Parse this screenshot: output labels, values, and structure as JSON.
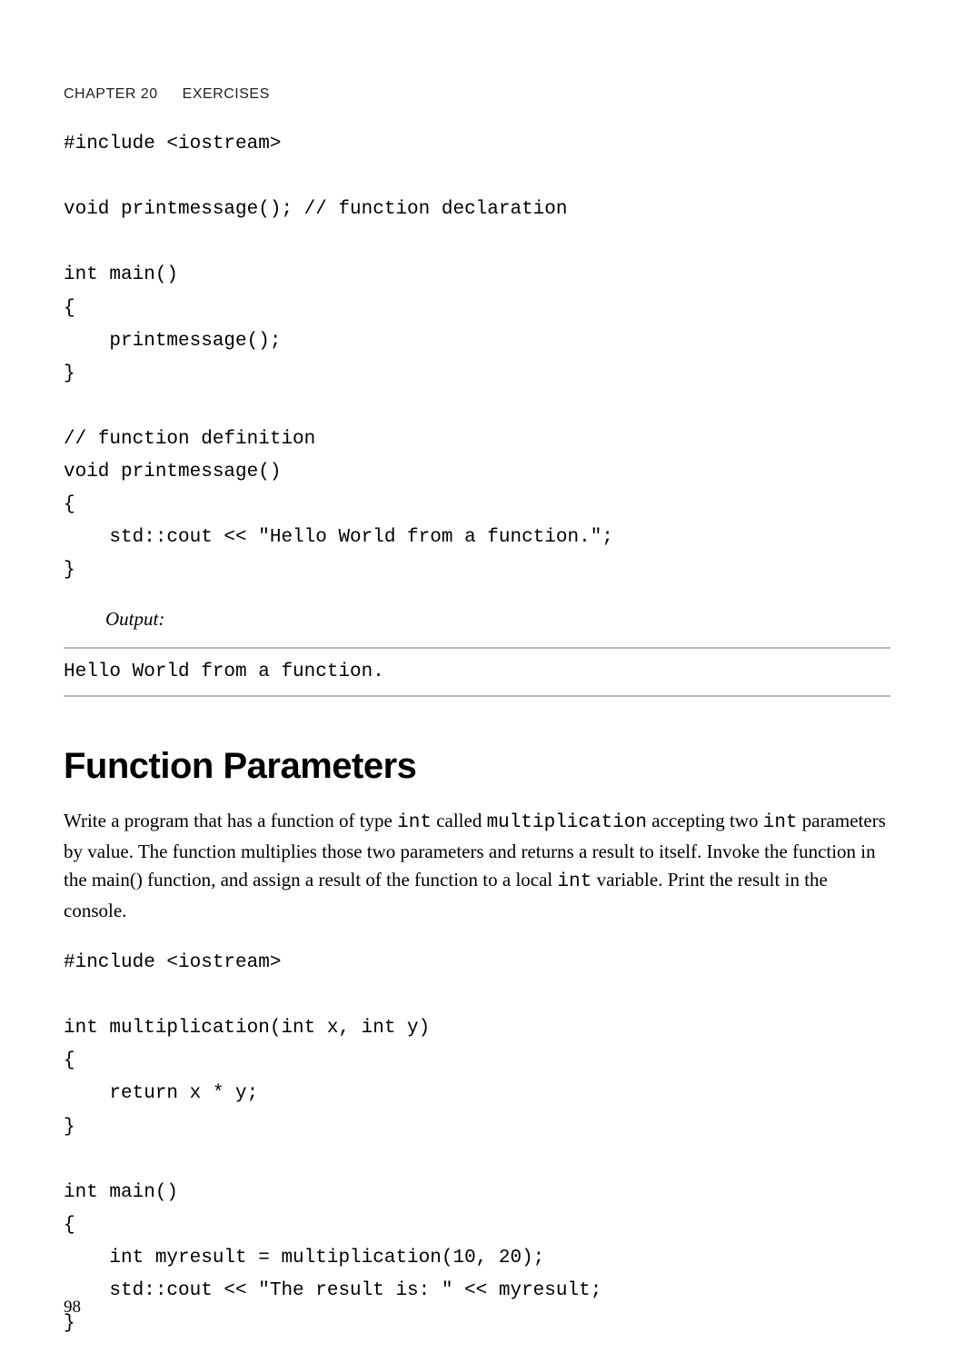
{
  "header": {
    "chapter": "CHAPTER 20",
    "title": "EXERCISES"
  },
  "code1": "#include <iostream>\n\nvoid printmessage(); // function declaration\n\nint main()\n{\n    printmessage();\n}\n\n// function definition\nvoid printmessage()\n{\n    std::cout << \"Hello World from a function.\";\n}",
  "outputLabel": "Output:",
  "output1": "Hello World from a function.",
  "section": {
    "title": "Function Parameters",
    "para_parts": [
      "Write a program that has a function of type ",
      "int",
      " called ",
      "multiplication",
      " accepting two ",
      "int",
      " parameters by value. The function multiplies those two parameters and returns a result to itself. Invoke the function in the main() function, and assign a result of the function to a local ",
      "int",
      " variable. Print the result in the console."
    ]
  },
  "code2": "#include <iostream>\n\nint multiplication(int x, int y)\n{\n    return x * y;\n}\n\nint main()\n{\n    int myresult = multiplication(10, 20);\n    std::cout << \"The result is: \" << myresult;\n}",
  "pageNumber": "98"
}
